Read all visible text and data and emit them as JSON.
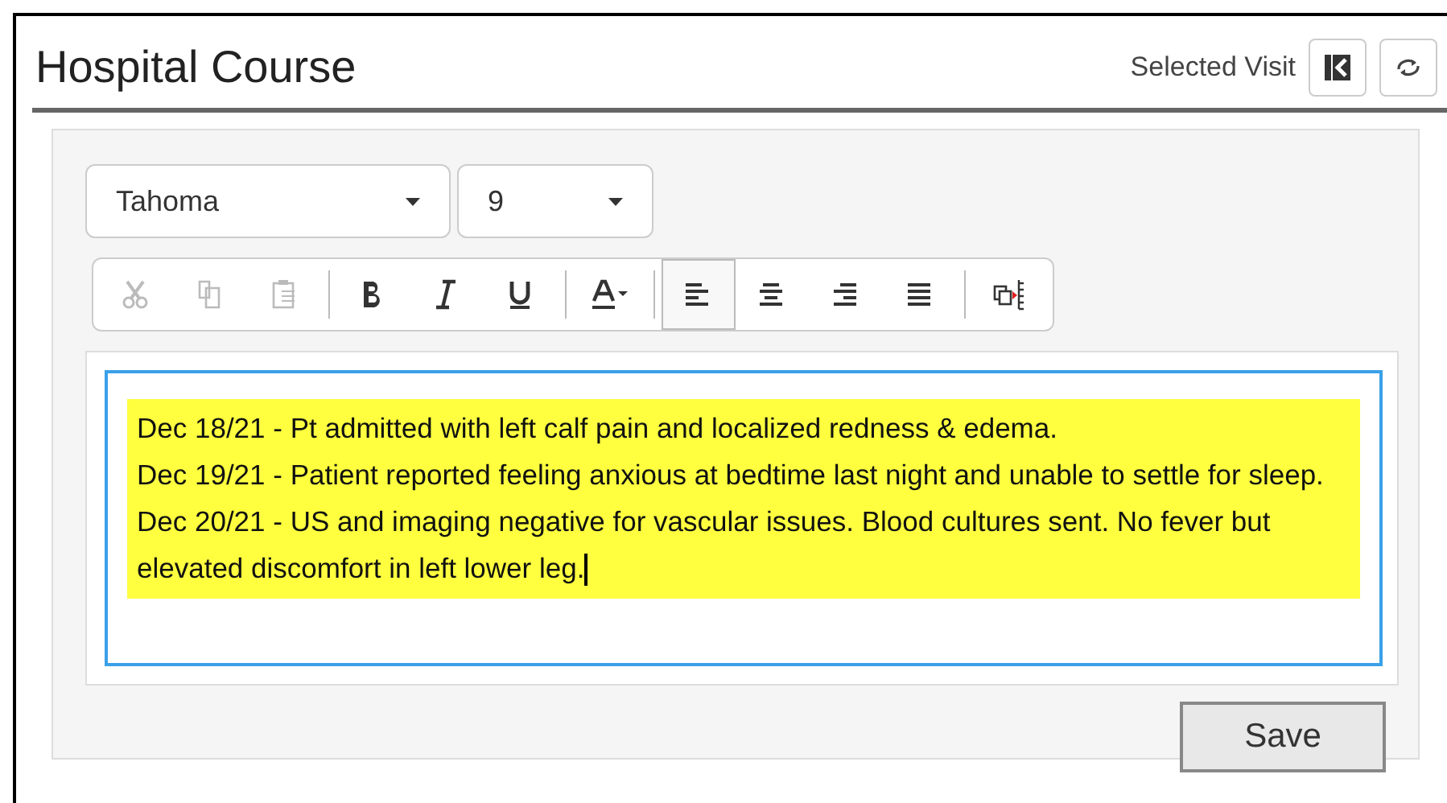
{
  "header": {
    "title": "Hospital Course",
    "selected_visit_label": "Selected Visit"
  },
  "font": {
    "family": "Tahoma",
    "size": "9"
  },
  "toolbar": [
    {
      "kind": "cut",
      "disabled": true,
      "selected": false
    },
    {
      "kind": "copy",
      "disabled": true,
      "selected": false
    },
    {
      "kind": "paste",
      "disabled": true,
      "selected": false
    },
    {
      "kind": "separator"
    },
    {
      "kind": "bold",
      "disabled": false,
      "selected": false
    },
    {
      "kind": "italic",
      "disabled": false,
      "selected": false
    },
    {
      "kind": "underline",
      "disabled": false,
      "selected": false
    },
    {
      "kind": "separator"
    },
    {
      "kind": "font-color",
      "disabled": false,
      "selected": false
    },
    {
      "kind": "separator"
    },
    {
      "kind": "align-left",
      "disabled": false,
      "selected": true
    },
    {
      "kind": "align-center",
      "disabled": false,
      "selected": false
    },
    {
      "kind": "align-right",
      "disabled": false,
      "selected": false
    },
    {
      "kind": "justify",
      "disabled": false,
      "selected": false
    },
    {
      "kind": "separator"
    },
    {
      "kind": "insert-field",
      "disabled": false,
      "selected": false
    }
  ],
  "editor": {
    "highlighted": true,
    "paragraphs": [
      "Dec 18/21 - Pt admitted with left calf pain and localized redness & edema.",
      "Dec 19/21 - Patient reported feeling anxious at bedtime last night and unable to settle for sleep.",
      "Dec 20/21 - US and imaging negative for vascular issues.  Blood cultures sent.  No fever but elevated discomfort in left lower leg."
    ]
  },
  "save_button": "Save"
}
